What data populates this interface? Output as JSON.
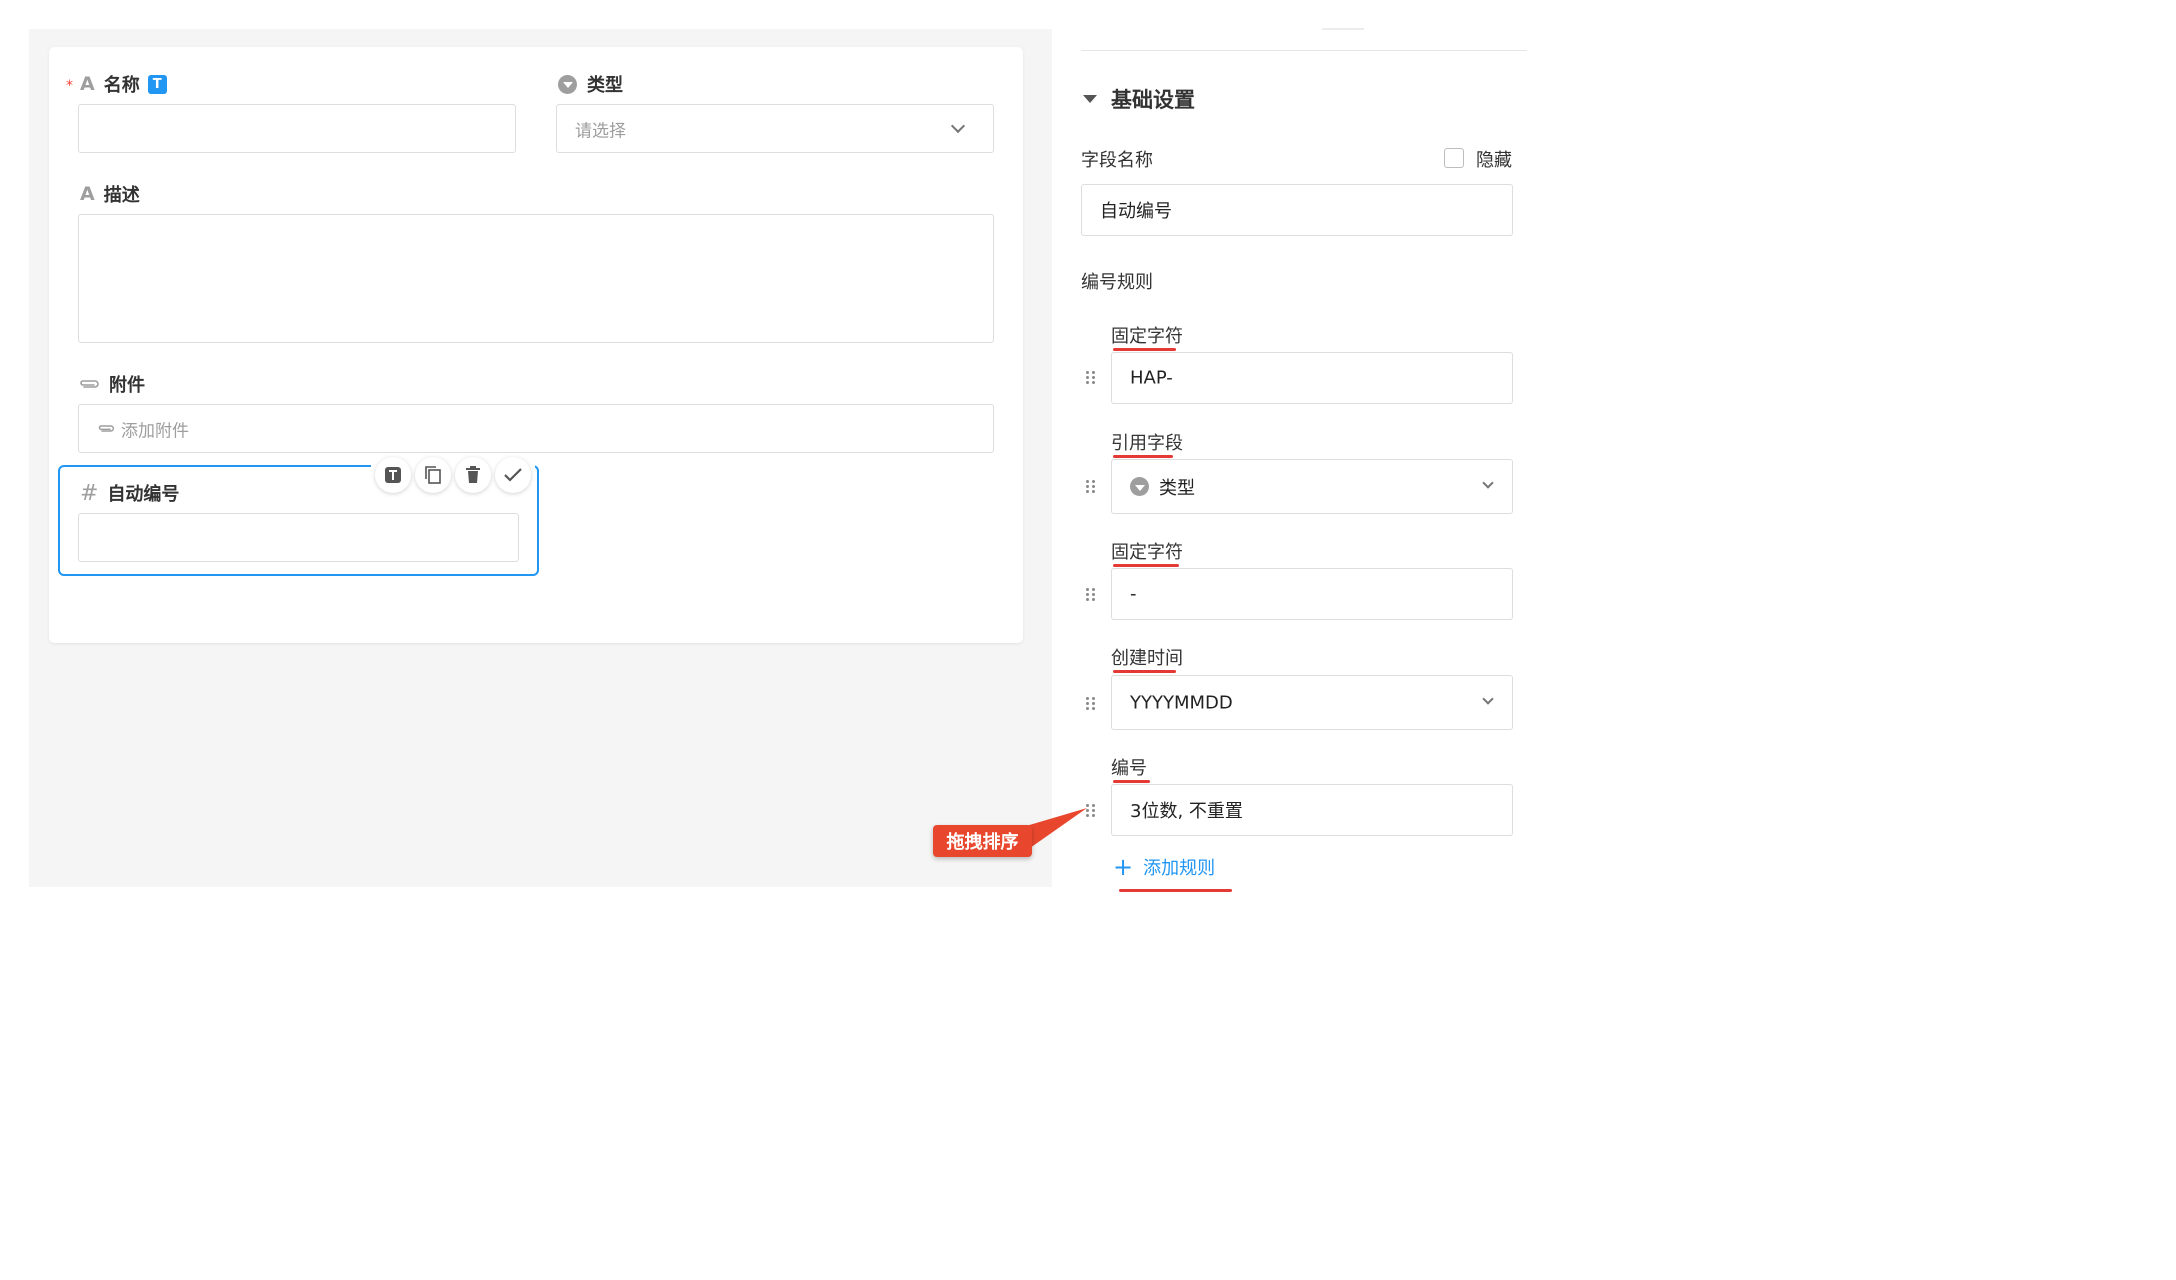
{
  "form": {
    "name_label": "名称",
    "name_badge": "T",
    "type_label": "类型",
    "type_placeholder": "请选择",
    "desc_label": "描述",
    "attach_label": "附件",
    "attach_button": "添加附件",
    "autonum_label": "自动编号"
  },
  "toolbar": {
    "items": [
      "text-type-icon",
      "copy-icon",
      "delete-icon",
      "confirm-icon"
    ]
  },
  "panel": {
    "section_title": "基础设置",
    "field_name_label": "字段名称",
    "hide_label": "隐藏",
    "field_name_value": "自动编号",
    "rules_label": "编号规则",
    "rules": [
      {
        "label": "固定字符",
        "value": "HAP-"
      },
      {
        "label": "引用字段",
        "value": "类型"
      },
      {
        "label": "固定字符",
        "value": "-"
      },
      {
        "label": "创建时间",
        "value": "YYYYMMDD"
      },
      {
        "label": "编号",
        "value": "3位数, 不重置"
      }
    ],
    "add_rule": "添加规则",
    "add_rule_plus": "+"
  },
  "annotation": {
    "callout": "拖拽排序",
    "color": "#e8472e"
  },
  "colors": {
    "accent": "#2196f3",
    "required": "#f44336",
    "annotation_underline": "#e53935"
  }
}
